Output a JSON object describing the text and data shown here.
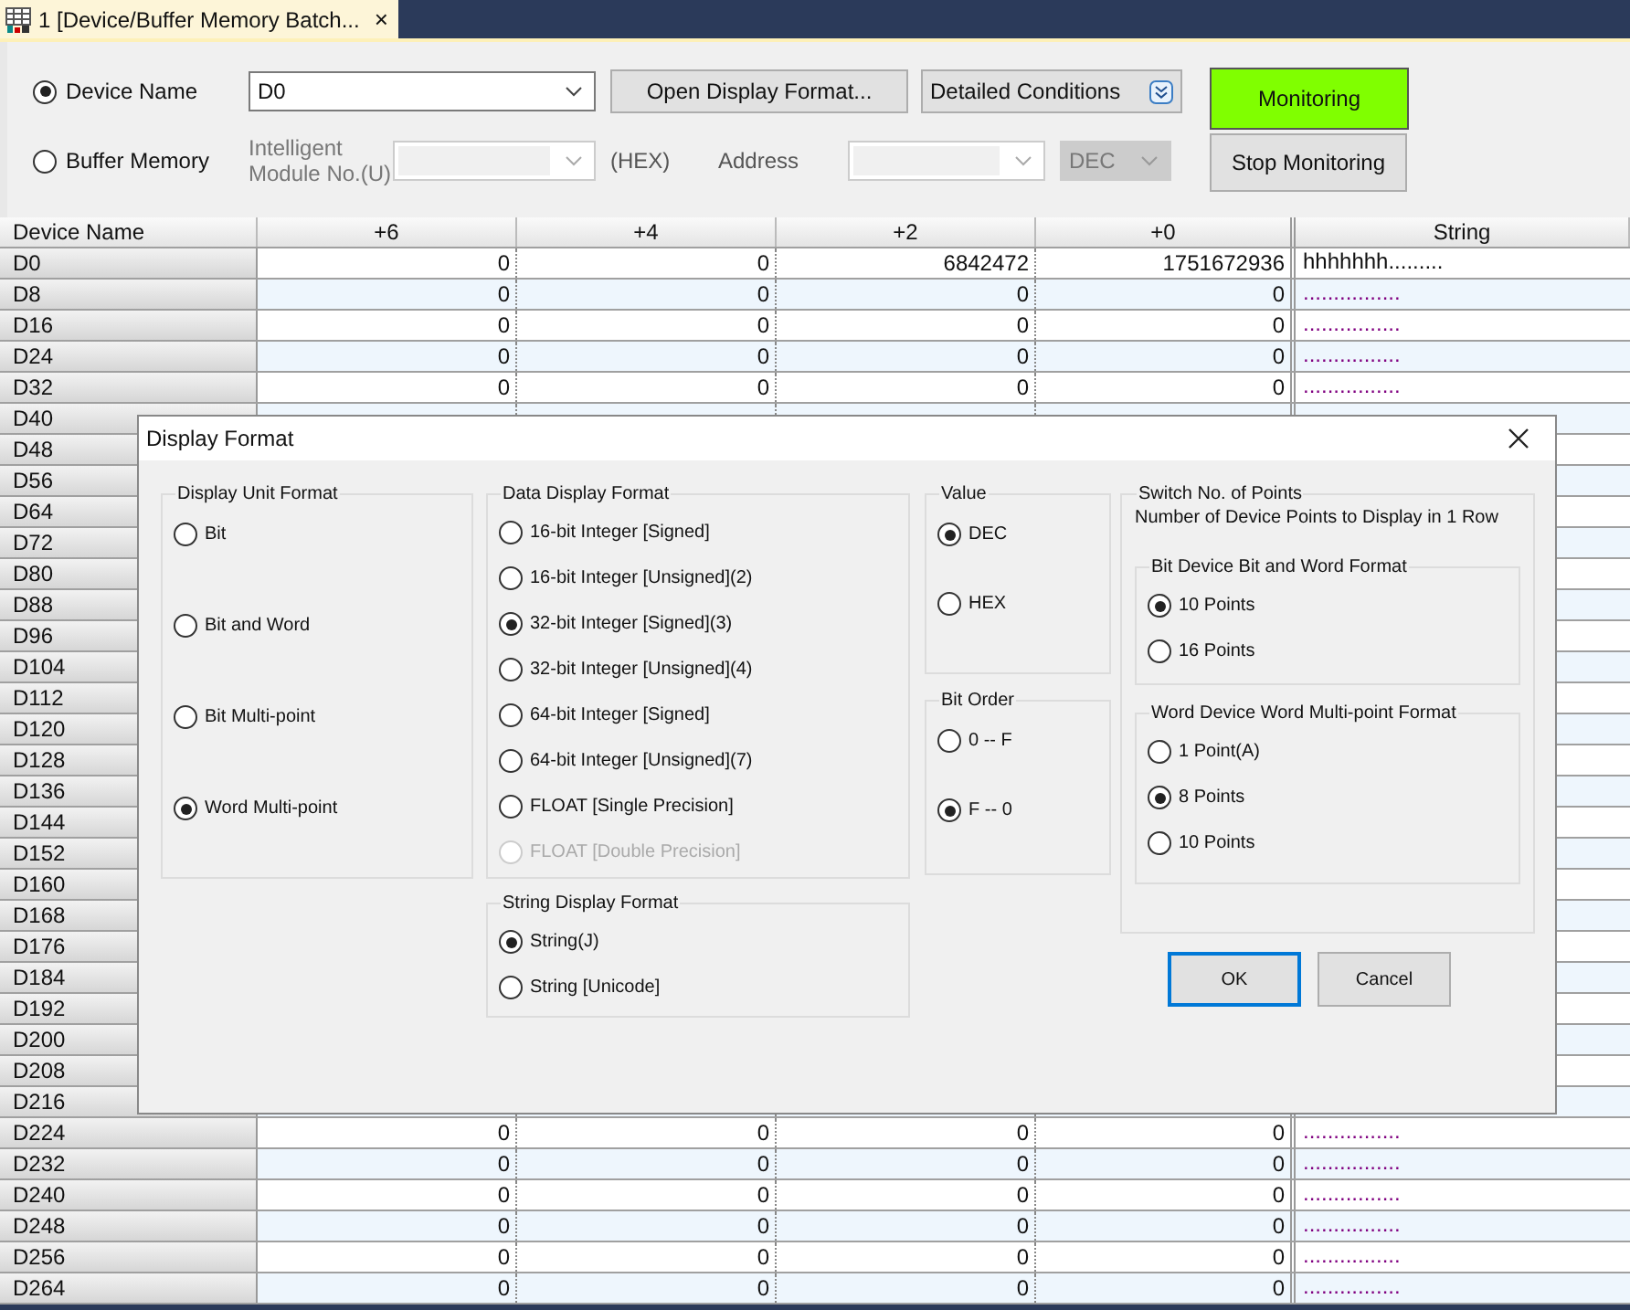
{
  "tab": {
    "title": "1 [Device/Buffer Memory Batch...",
    "close": "×"
  },
  "mode_options": [
    {
      "label": "Device Name",
      "selected": true
    },
    {
      "label": "Buffer Memory",
      "selected": false
    }
  ],
  "device_field": {
    "value": "D0"
  },
  "open_display_format_button": "Open Display Format...",
  "detailed_conditions": "Detailed Conditions",
  "intelligent_module_label": "Intelligent Module No.(U)",
  "hex_label": "(HEX)",
  "address_label": "Address",
  "address_format": {
    "value": "DEC",
    "disabled": true
  },
  "monitoring_button": {
    "label": "Monitoring",
    "active": true
  },
  "stop_button": {
    "label": "Stop Monitoring",
    "active": false
  },
  "table": {
    "columns": [
      "Device Name",
      "+6",
      "+4",
      "+2",
      "+0",
      "String"
    ],
    "rows": [
      {
        "name": "D0",
        "cells": [
          "0",
          "0",
          "6842472",
          "1751672936"
        ],
        "string": "hhhhhhh........."
      },
      {
        "name": "D8",
        "cells": [
          "0",
          "0",
          "0",
          "0"
        ],
        "string": "................"
      },
      {
        "name": "D16",
        "cells": [
          "0",
          "0",
          "0",
          "0"
        ],
        "string": "................"
      },
      {
        "name": "D24",
        "cells": [
          "0",
          "0",
          "0",
          "0"
        ],
        "string": "................"
      },
      {
        "name": "D32",
        "cells": [
          "0",
          "0",
          "0",
          "0"
        ],
        "string": "................"
      },
      {
        "name": "D40"
      },
      {
        "name": "D48"
      },
      {
        "name": "D56"
      },
      {
        "name": "D64"
      },
      {
        "name": "D72"
      },
      {
        "name": "D80"
      },
      {
        "name": "D88"
      },
      {
        "name": "D96"
      },
      {
        "name": "D104"
      },
      {
        "name": "D112"
      },
      {
        "name": "D120"
      },
      {
        "name": "D128"
      },
      {
        "name": "D136"
      },
      {
        "name": "D144"
      },
      {
        "name": "D152"
      },
      {
        "name": "D160"
      },
      {
        "name": "D168"
      },
      {
        "name": "D176"
      },
      {
        "name": "D184"
      },
      {
        "name": "D192"
      },
      {
        "name": "D200"
      },
      {
        "name": "D208"
      },
      {
        "name": "D216"
      },
      {
        "name": "D224",
        "cells": [
          "0",
          "0",
          "0",
          "0"
        ],
        "string": "................"
      },
      {
        "name": "D232",
        "cells": [
          "0",
          "0",
          "0",
          "0"
        ],
        "string": "................"
      },
      {
        "name": "D240",
        "cells": [
          "0",
          "0",
          "0",
          "0"
        ],
        "string": "................"
      },
      {
        "name": "D248",
        "cells": [
          "0",
          "0",
          "0",
          "0"
        ],
        "string": "................"
      },
      {
        "name": "D256",
        "cells": [
          "0",
          "0",
          "0",
          "0"
        ],
        "string": "................"
      },
      {
        "name": "D264",
        "cells": [
          "0",
          "0",
          "0",
          "0"
        ],
        "string": "................"
      }
    ]
  },
  "dialog": {
    "title": "Display Format",
    "display_unit_format": {
      "title": "Display Unit Format",
      "options": [
        {
          "label": "Bit",
          "selected": false,
          "disabled": false
        },
        {
          "label": "Bit and Word",
          "selected": false,
          "disabled": false
        },
        {
          "label": "Bit Multi-point",
          "selected": false,
          "disabled": false
        },
        {
          "label": "Word Multi-point",
          "selected": true,
          "disabled": false
        }
      ]
    },
    "data_display_format": {
      "title": "Data Display Format",
      "options": [
        {
          "label": "16-bit Integer [Signed]",
          "selected": false,
          "disabled": false
        },
        {
          "label": "16-bit Integer [Unsigned](2)",
          "selected": false,
          "disabled": false
        },
        {
          "label": "32-bit Integer [Signed](3)",
          "selected": true,
          "disabled": false
        },
        {
          "label": "32-bit Integer [Unsigned](4)",
          "selected": false,
          "disabled": false
        },
        {
          "label": "64-bit Integer [Signed]",
          "selected": false,
          "disabled": false
        },
        {
          "label": "64-bit Integer [Unsigned](7)",
          "selected": false,
          "disabled": false
        },
        {
          "label": "FLOAT [Single Precision]",
          "selected": false,
          "disabled": false
        },
        {
          "label": "FLOAT [Double Precision]",
          "selected": false,
          "disabled": true
        }
      ]
    },
    "string_display_format": {
      "title": "String Display Format",
      "options": [
        {
          "label": "String(J)",
          "selected": true,
          "disabled": false
        },
        {
          "label": "String [Unicode]",
          "selected": false,
          "disabled": false
        }
      ]
    },
    "value": {
      "title": "Value",
      "options": [
        {
          "label": "DEC",
          "selected": true,
          "disabled": false
        },
        {
          "label": "HEX",
          "selected": false,
          "disabled": false
        }
      ]
    },
    "bit_order": {
      "title": "Bit Order",
      "options": [
        {
          "label": "0 -- F",
          "selected": false,
          "disabled": false
        },
        {
          "label": "F -- 0",
          "selected": true,
          "disabled": false
        }
      ]
    },
    "switch_points": {
      "title": "Switch No. of Points",
      "note": "Number of Device Points to Display in 1 Row",
      "bit_device": {
        "title": "Bit Device Bit and Word Format",
        "options": [
          {
            "label": "10 Points",
            "selected": true,
            "disabled": false
          },
          {
            "label": "16 Points",
            "selected": false,
            "disabled": false
          }
        ]
      },
      "word_device": {
        "title": "Word Device Word Multi-point Format",
        "options": [
          {
            "label": "1 Point(A)",
            "selected": false,
            "disabled": false
          },
          {
            "label": "8 Points",
            "selected": true,
            "disabled": false
          },
          {
            "label": "10 Points",
            "selected": false,
            "disabled": false
          }
        ]
      }
    },
    "ok_button": "OK",
    "cancel_button": "Cancel"
  }
}
